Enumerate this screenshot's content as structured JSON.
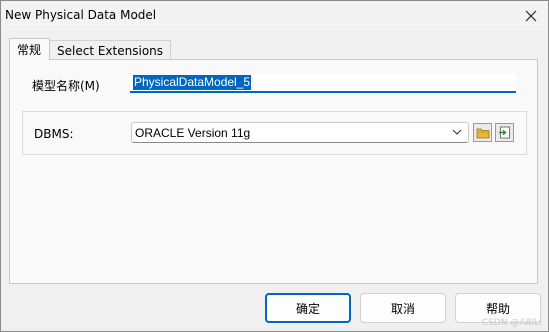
{
  "window": {
    "title": "New Physical Data Model"
  },
  "tabs": [
    {
      "label": "常规",
      "active": true
    },
    {
      "label": "Select Extensions",
      "active": false
    }
  ],
  "general": {
    "name_label": "模型名称(M)",
    "name_value": "PhysicalDataModel_5",
    "dbms_label": "DBMS:",
    "dbms_value": "ORACLE Version 11g"
  },
  "icons": {
    "close": "close-icon",
    "dropdown": "chevron-down-icon",
    "browse": "folder-icon",
    "import": "import-icon"
  },
  "buttons": {
    "ok": "确定",
    "cancel": "取消",
    "help": "帮助"
  },
  "watermark": "CSDN @ABILI",
  "colors": {
    "accent": "#0067c0",
    "folder": "#e8b73a",
    "import": "#2e8b2e"
  }
}
